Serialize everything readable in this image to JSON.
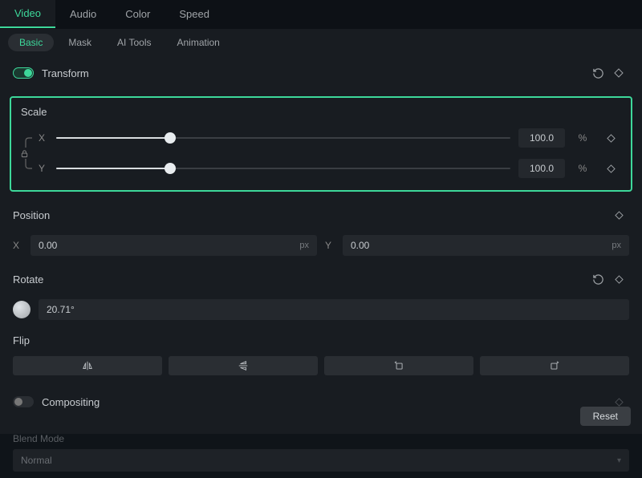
{
  "mainTabs": {
    "items": [
      "Video",
      "Audio",
      "Color",
      "Speed"
    ],
    "active": 0
  },
  "subTabs": {
    "items": [
      "Basic",
      "Mask",
      "AI Tools",
      "Animation"
    ],
    "active": 0
  },
  "transform": {
    "label": "Transform",
    "enabled": true
  },
  "scale": {
    "label": "Scale",
    "x": {
      "label": "X",
      "value": "100.0",
      "unit": "%",
      "percent": 25
    },
    "y": {
      "label": "Y",
      "value": "100.0",
      "unit": "%",
      "percent": 25
    }
  },
  "position": {
    "label": "Position",
    "x": {
      "label": "X",
      "value": "0.00",
      "unit": "px"
    },
    "y": {
      "label": "Y",
      "value": "0.00",
      "unit": "px"
    }
  },
  "rotate": {
    "label": "Rotate",
    "value": "20.71°"
  },
  "flip": {
    "label": "Flip"
  },
  "compositing": {
    "label": "Compositing",
    "enabled": false
  },
  "blend": {
    "label": "Blend Mode",
    "value": "Normal"
  },
  "footer": {
    "reset": "Reset"
  }
}
